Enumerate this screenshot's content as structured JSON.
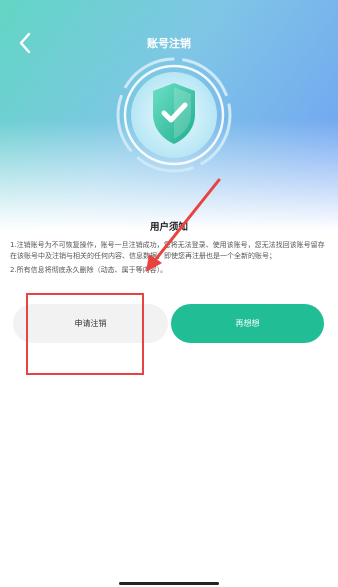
{
  "header": {
    "title": "账号注销",
    "back_icon": "chevron-left-icon"
  },
  "hero": {
    "icon": "shield-check-icon",
    "colors": {
      "gradient_start": "#62d6c4",
      "gradient_end": "#6f9ff4",
      "shield": "#21be96"
    }
  },
  "notice": {
    "title": "用户须知",
    "line1": "1.注销账号为不可恢复操作，账号一旦注销成功，您将无法登录、使用该账号，您无法找回该账号留存在该账号中及注销与相关的任何内容、信息数据，即使您再注册也是一个全新的账号；",
    "line2": "2.所有信息将彻底永久删除（动态、属于等内容）。"
  },
  "actions": {
    "apply_label": "申请注销",
    "think_label": "再想想",
    "apply_color": "#f2f2f2",
    "think_color": "#21be96"
  },
  "annotation": {
    "color": "#e8443f"
  }
}
